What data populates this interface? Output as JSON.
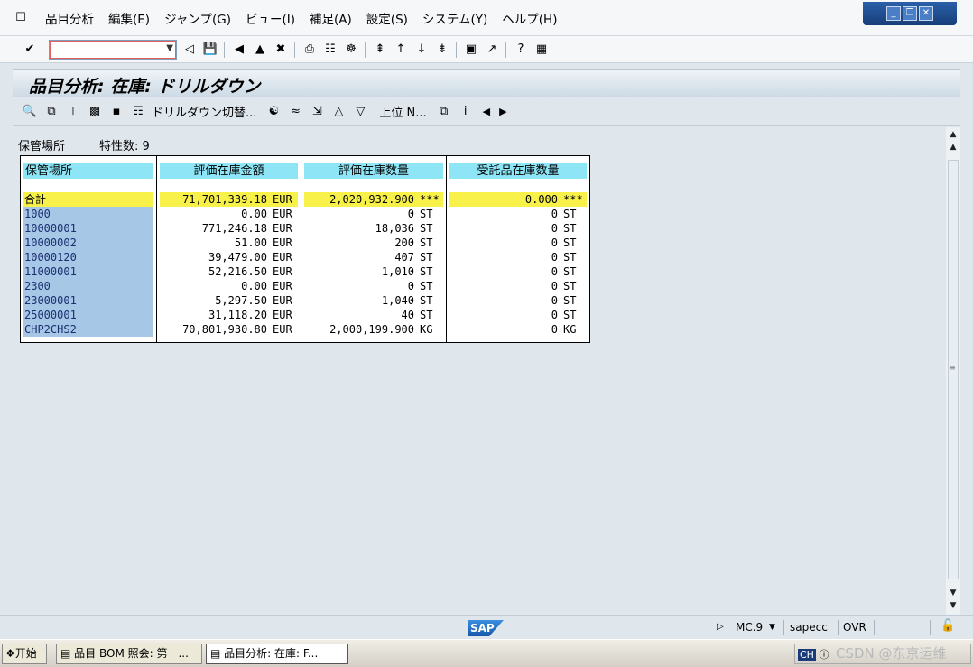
{
  "menu": {
    "items": [
      "品目分析",
      "編集(E)",
      "ジャンプ(G)",
      "ビュー(I)",
      "補足(A)",
      "設定(S)",
      "システム(Y)",
      "ヘルプ(H)"
    ]
  },
  "title": "品目分析: 在庫: ドリルダウン",
  "app_toolbar": {
    "drilldown_label": "ドリルダウン切替...",
    "upper_label": "上位 N..."
  },
  "header": {
    "label": "保管場所",
    "count_label": "特性数: 9"
  },
  "table": {
    "columns": [
      "保管場所",
      "評価在庫金額",
      "評価在庫数量",
      "受託品在庫数量"
    ],
    "total": {
      "label": "合計",
      "amount": "71,701,339.18",
      "amount_unit": "EUR",
      "qty": "2,020,932.900",
      "qty_unit": "***",
      "consign": "0.000",
      "consign_unit": "***"
    },
    "rows": [
      {
        "loc": "1000",
        "amount": "0.00",
        "cur": "EUR",
        "qty": "0",
        "qunit": "ST",
        "consign": "0",
        "cunit": "ST"
      },
      {
        "loc": "10000001",
        "amount": "771,246.18",
        "cur": "EUR",
        "qty": "18,036",
        "qunit": "ST",
        "consign": "0",
        "cunit": "ST"
      },
      {
        "loc": "10000002",
        "amount": "51.00",
        "cur": "EUR",
        "qty": "200",
        "qunit": "ST",
        "consign": "0",
        "cunit": "ST"
      },
      {
        "loc": "10000120",
        "amount": "39,479.00",
        "cur": "EUR",
        "qty": "407",
        "qunit": "ST",
        "consign": "0",
        "cunit": "ST"
      },
      {
        "loc": "11000001",
        "amount": "52,216.50",
        "cur": "EUR",
        "qty": "1,010",
        "qunit": "ST",
        "consign": "0",
        "cunit": "ST"
      },
      {
        "loc": "2300",
        "amount": "0.00",
        "cur": "EUR",
        "qty": "0",
        "qunit": "ST",
        "consign": "0",
        "cunit": "ST"
      },
      {
        "loc": "23000001",
        "amount": "5,297.50",
        "cur": "EUR",
        "qty": "1,040",
        "qunit": "ST",
        "consign": "0",
        "cunit": "ST"
      },
      {
        "loc": "25000001",
        "amount": "31,118.20",
        "cur": "EUR",
        "qty": "40",
        "qunit": "ST",
        "consign": "0",
        "cunit": "ST"
      },
      {
        "loc": "CHP2CHS2",
        "amount": "70,801,930.80",
        "cur": "EUR",
        "qty": "2,000,199.900",
        "qunit": "KG",
        "consign": "0",
        "cunit": "KG"
      }
    ]
  },
  "status": {
    "logo": "SAP",
    "system": "MC.9",
    "host": "sapecc",
    "mode": "OVR"
  },
  "taskbar": {
    "start": "开始",
    "items": [
      "品目 BOM 照会: 第一...",
      "品目分析: 在庫: F..."
    ],
    "tray_ime": "CH",
    "watermark": "CSDN @东京运维"
  },
  "colors": {
    "column_header": "#8ee5f6",
    "key_cell": "#a7c7e6",
    "total_highlight": "#f7f14a"
  }
}
